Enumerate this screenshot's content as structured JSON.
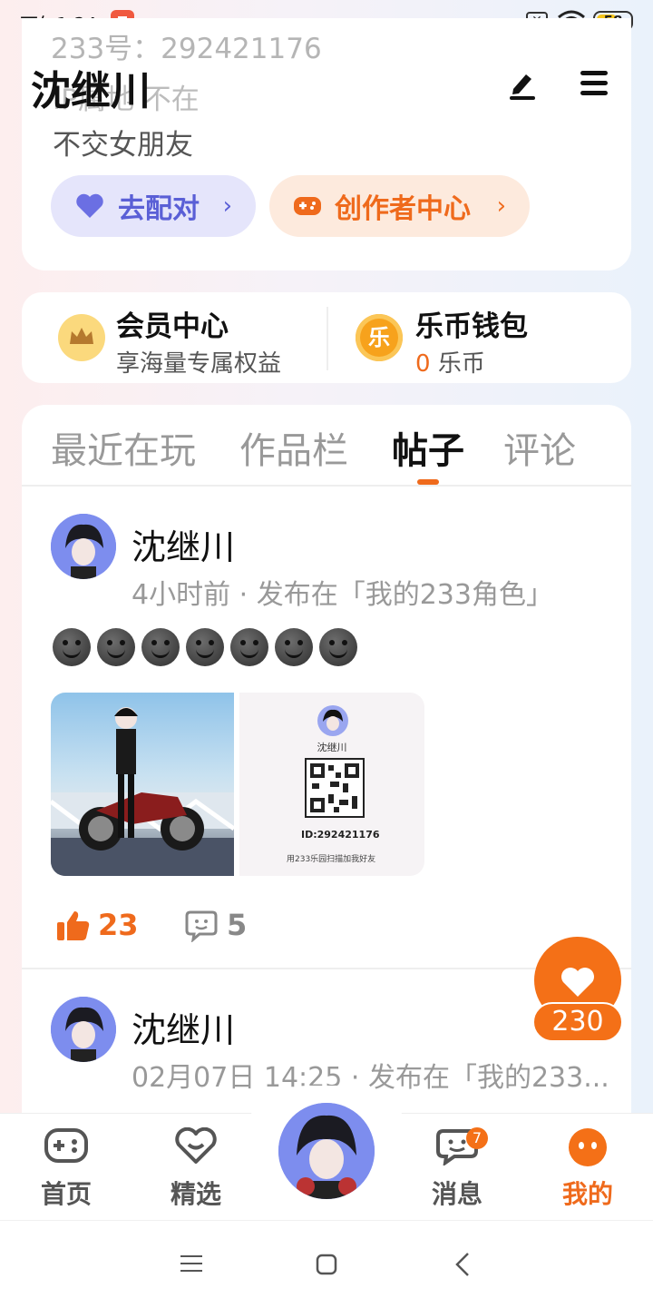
{
  "status_bar": {
    "time": "下午1:24",
    "battery": "58"
  },
  "profile": {
    "id_line": "233号：292421176",
    "location_line": "IP属地 不在",
    "name": "沈继川",
    "bio": "不交女朋友",
    "match_button": "去配对",
    "creator_button": "创作者中心"
  },
  "member": {
    "title": "会员中心",
    "subtitle": "享海量专属权益"
  },
  "wallet": {
    "title": "乐币钱包",
    "coin_icon_text": "乐",
    "count": "0",
    "unit": "乐币"
  },
  "tabs": [
    "最近在玩",
    "作品栏",
    "帖子",
    "评论"
  ],
  "posts": [
    {
      "author": "沈继川",
      "meta": "4小时前 · 发布在「我的233角色」",
      "qr_name": "沈继川",
      "qr_id": "ID:292421176",
      "qr_hint": "用233乐园扫描加我好友",
      "likes": "23",
      "comments": "5"
    },
    {
      "author": "沈继川",
      "meta": "02月07日 14:25 · 发布在「我的233..."
    }
  ],
  "fab": {
    "count": "230"
  },
  "nav": {
    "home": "首页",
    "featured": "精选",
    "messages": "消息",
    "messages_badge": "7",
    "mine": "我的"
  },
  "colors": {
    "accent": "#ef6a1c",
    "match": "#5a5fd6"
  }
}
